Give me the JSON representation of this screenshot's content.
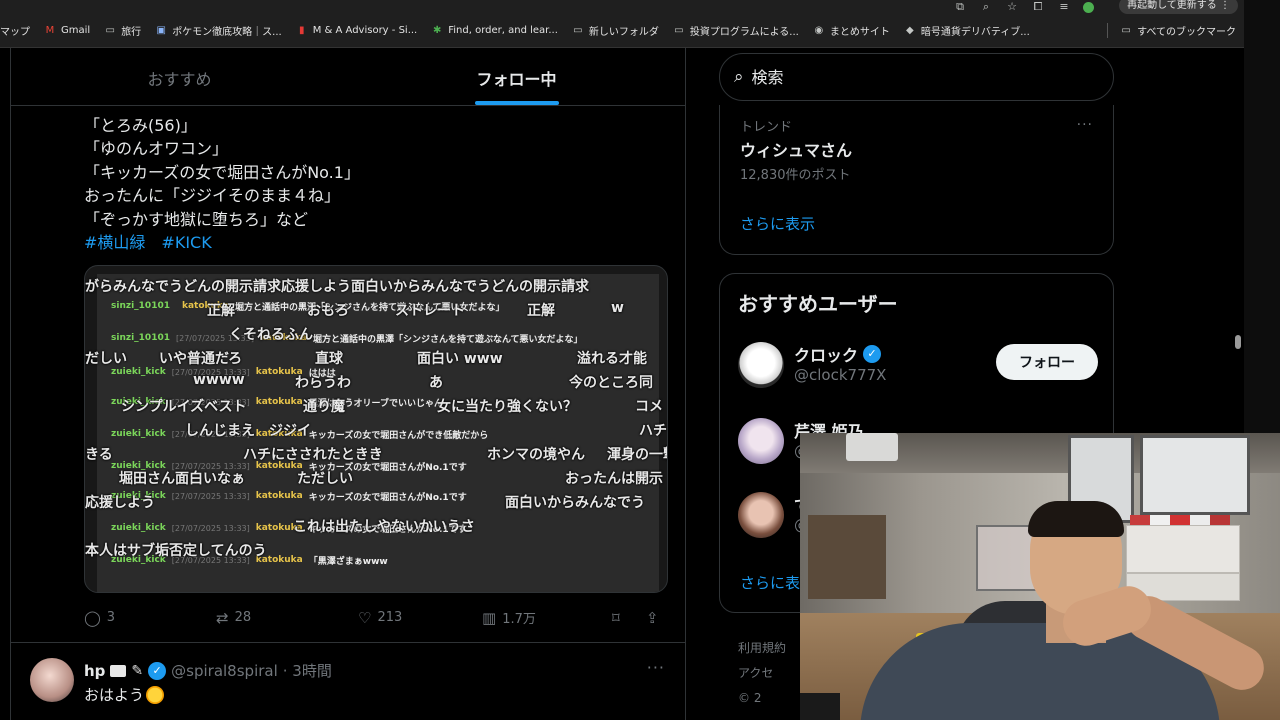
{
  "browser": {
    "update_label": "再起動して更新する",
    "bookmarks": [
      {
        "icon": "map-icon",
        "label": "マップ"
      },
      {
        "icon": "gmail-icon",
        "label": "Gmail"
      },
      {
        "icon": "folder-icon",
        "label": "旅行"
      },
      {
        "icon": "pokemon-site-icon",
        "label": "ポケモン徹底攻略｜ス..."
      },
      {
        "icon": "ma-advisory-icon",
        "label": "M & A Advisory - Si..."
      },
      {
        "icon": "find-order-icon",
        "label": "Find, order, and lear..."
      },
      {
        "icon": "folder-icon",
        "label": "新しいフォルダ"
      },
      {
        "icon": "folder-icon",
        "label": "投資プログラムによる..."
      },
      {
        "icon": "matome-icon",
        "label": "まとめサイト"
      },
      {
        "icon": "crypto-icon",
        "label": "暗号通貨デリバティブ..."
      }
    ],
    "all_bookmarks": "すべてのブックマーク"
  },
  "feed": {
    "tabs": [
      {
        "label": "おすすめ",
        "active": false
      },
      {
        "label": "フォロー中",
        "active": true
      }
    ],
    "post": {
      "lines": [
        "「とろみ(56)」",
        "「ゆのんオワコン」",
        "「キッカーズの女で堀田さんがNo.1」",
        "おったんに「ジジイそのまま４ね」",
        "「ぞっかす地獄に堕ちろ」など"
      ],
      "hashtags": [
        "#横山緑",
        "#KICK"
      ],
      "media": {
        "chat_rows": [
          {
            "user": "sinzi_10101",
            "time": "",
            "user2": "katokuka",
            "msg": "堀方と通話中の黒澤「シンジさんを持て遊ぶなんて悪い女だよな」"
          },
          {
            "user": "sinzi_10101",
            "time": "[27/07/2025 13:33]",
            "user2": "katokuka",
            "msg": "堀方と通話中の黒澤「シンジさんを持て遊ぶなんて悪い女だよな」"
          },
          {
            "user": "zuieki_kick",
            "time": "[27/07/2025 13:33]",
            "user2": "katokuka",
            "msg": "ははは"
          },
          {
            "user": "zuieki_kick",
            "time": "[27/07/2025 13:33]",
            "user2": "katokuka",
            "msg": "黒澤はもうオリーブでいいじゃん"
          },
          {
            "user": "zuieki_kick",
            "time": "[27/07/2025 13:33]",
            "user2": "katokuka",
            "msg": "キッカーズの女で堀田さんができ低敵だから"
          },
          {
            "user": "zuieki_kick",
            "time": "[27/07/2025 13:33]",
            "user2": "katokuka",
            "msg": "キッカーズの女で堀田さんがNo.1です"
          },
          {
            "user": "zuieki_kick",
            "time": "[27/07/2025 13:33]",
            "user2": "katokuka",
            "msg": "キッカーズの女で堀田さんがNo.1です"
          },
          {
            "user": "zuieki_kick",
            "time": "[27/07/2025 13:33]",
            "user2": "katokuka",
            "msg": "キッカーズの女で堀田さんがNo.1です"
          },
          {
            "user": "zuieki_kick",
            "time": "[27/07/2025 13:33]",
            "user2": "katokuka",
            "msg": "「黒澤ざまぁwww"
          }
        ],
        "overlay": [
          "がらみんなでうどんの開示請求応援しよう面白いからみんなでうどんの開示請求",
          "正解",
          "おもろ",
          "ストレート",
          "正解",
          "w",
          "くそねるふん",
          "だしい",
          "いや普通だろ",
          "直球",
          "面白い www",
          "溢れる才能",
          "wwww",
          "わらうわ",
          "あ",
          "今のところ同",
          "シンプルイズベスト",
          "通り魔",
          "女に当たり強くない？",
          "コメ",
          "しんじまえ　ジジイ",
          "ハチ",
          "きる",
          "ハチにさされたときき",
          "ホンマの境やん",
          "渾身の一撃",
          "堀田さん面白いなぁ",
          "ただしい",
          "おったんは開示",
          "応援しよう",
          "面白いからみんなでう",
          "これは出たしやないかいうさ",
          "本人はサブ垢否定してんのう"
        ]
      },
      "stats": {
        "replies": "3",
        "reposts": "28",
        "likes": "213",
        "views": "1.7万"
      }
    },
    "post2": {
      "name": "hp",
      "handle": "@spiral8spiral",
      "time": "· 3時間",
      "text": "おはよう",
      "more": "···"
    }
  },
  "sidebar": {
    "search_placeholder": "検索",
    "trend": {
      "category": "トレンド",
      "name": "ウィシュマさん",
      "count": "12,830件のポスト",
      "more": "···",
      "show_more": "さらに表示"
    },
    "recommended": {
      "title": "おすすめユーザー",
      "users": [
        {
          "name": "クロック",
          "handle": "@clock777X",
          "verified": true,
          "button": "フォロー"
        },
        {
          "name": "芹澤 姫乃",
          "handle": "@",
          "verified": false,
          "button": ""
        },
        {
          "name": "で",
          "handle": "@",
          "verified": false,
          "button": ""
        }
      ],
      "show_more": "さらに表"
    },
    "footer": [
      "利用規約",
      "アクセ",
      "© 2"
    ]
  },
  "colors": {
    "accent": "#1d9bf0",
    "background": "#000000",
    "border": "#2f3336",
    "muted": "#71767b"
  }
}
